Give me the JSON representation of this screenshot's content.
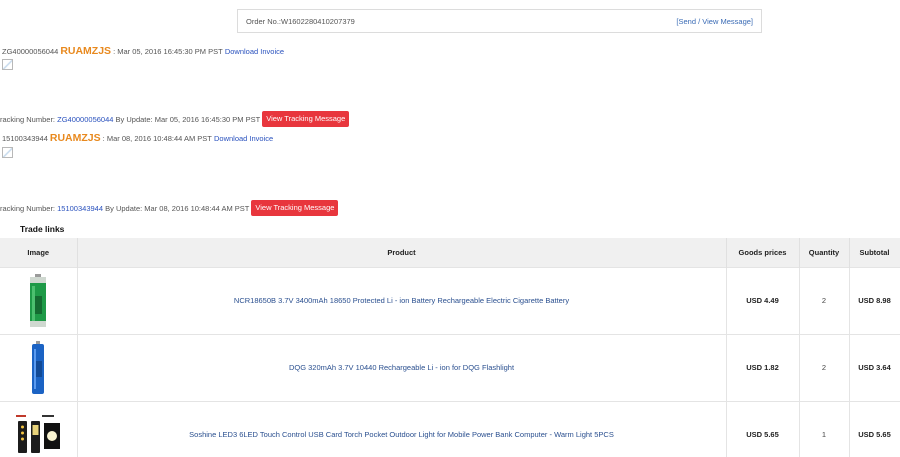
{
  "order": {
    "order_no": "Order No.:W1602280410207379",
    "message_link": "[Send / View Message]"
  },
  "shipments": [
    {
      "ship_prefix": "ZG40000056044",
      "brand": "RUAMZJS",
      "date_text": ": Mar 05, 2016 16:45:30 PM PST",
      "invoice_link": "Download Invoice",
      "tracking_label": "racking Number:",
      "tracking_number": "ZG40000056044",
      "update_text": "By Update: Mar 05, 2016 16:45:30 PM PST",
      "tracking_button": "View Tracking Message"
    },
    {
      "ship_prefix": "15100343944",
      "brand": "RUAMZJS",
      "date_text": ": Mar 08, 2016 10:48:44 AM PST",
      "invoice_link": "Download Invoice",
      "tracking_label": "racking Number:",
      "tracking_number": "15100343944",
      "update_text": "By Update: Mar 08, 2016 10:48:44 AM PST",
      "tracking_button": "View Tracking Message"
    }
  ],
  "trade": {
    "title": "Trade links",
    "headers": [
      "Image",
      "Product",
      "Goods prices",
      "Quantity",
      "Subtotal"
    ],
    "rows": [
      {
        "image": "green-battery-image",
        "product": "NCR18650B 3.7V 3400mAh 18650 Protected Li - ion Battery Rechargeable Electric Cigarette Battery",
        "price": "USD 4.49",
        "quantity": "2",
        "subtotal": "USD 8.98"
      },
      {
        "image": "blue-battery-image",
        "product": "DQG 320mAh 3.7V 10440 Rechargeable Li - ion for DQG Flashlight",
        "price": "USD 1.82",
        "quantity": "2",
        "subtotal": "USD 3.64"
      },
      {
        "image": "usb-led-light-image",
        "product": "Soshine LED3 6LED Touch Control USB Card Torch Pocket Outdoor Light for Mobile Power Bank Computer - Warm Light 5PCS",
        "price": "USD 5.65",
        "quantity": "1",
        "subtotal": "USD 5.65"
      }
    ]
  },
  "colors": {
    "brand": "#e8891e",
    "button_red": "#e8363d",
    "link_blue": "#2a52be",
    "header_bg": "#f0f0f0"
  }
}
